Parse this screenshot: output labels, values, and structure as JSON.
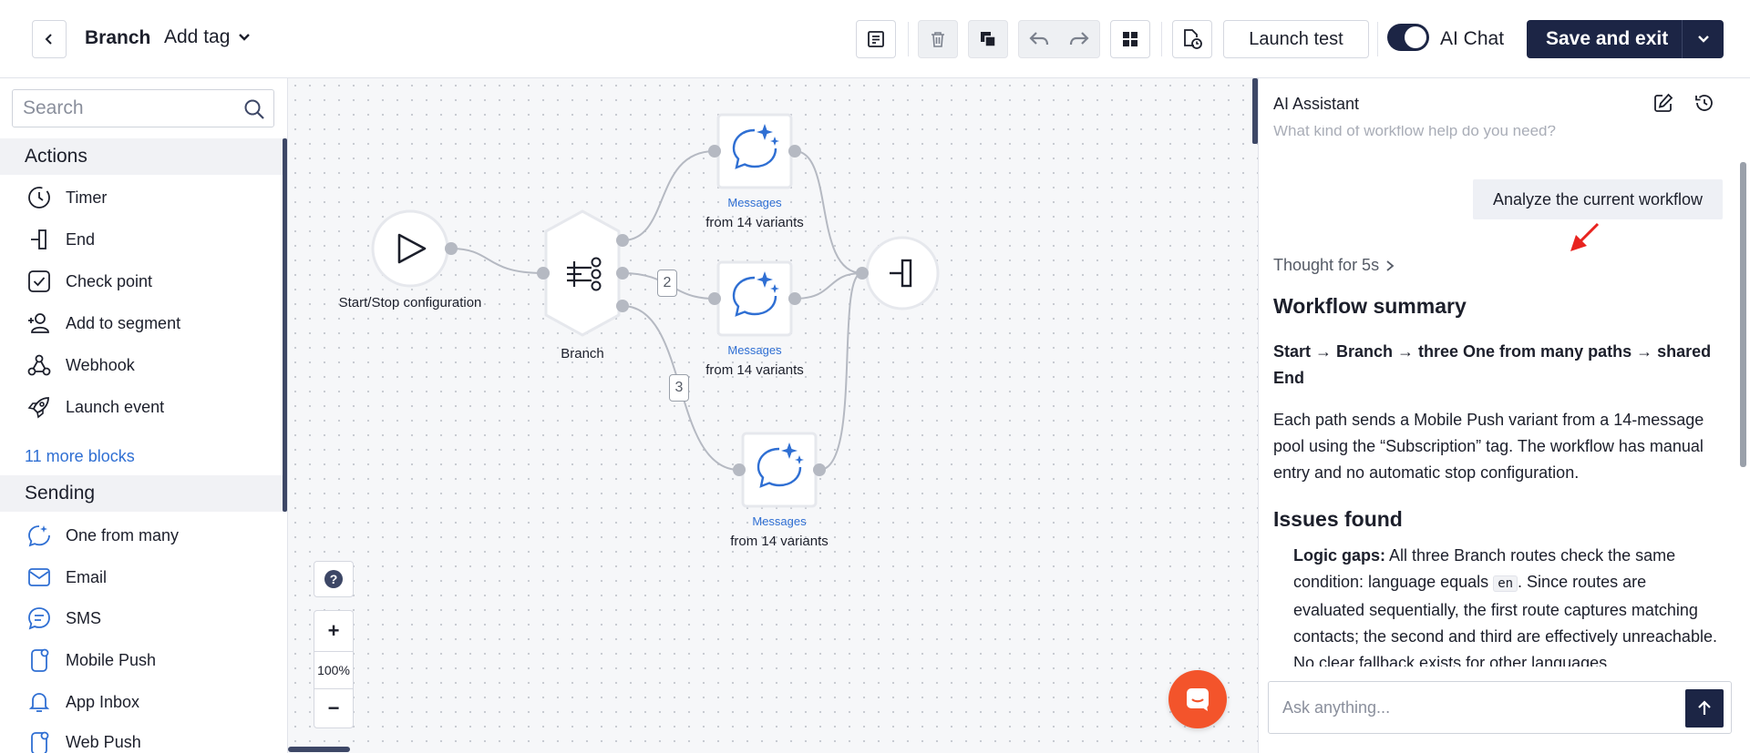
{
  "header": {
    "title": "Branch",
    "add_tag": "Add tag",
    "launch_test": "Launch test",
    "ai_chat": "AI Chat",
    "save_exit": "Save and exit"
  },
  "sidebar": {
    "search_placeholder": "Search",
    "sections": [
      {
        "title": "Actions",
        "items": [
          {
            "label": "Timer",
            "icon": "timer-icon"
          },
          {
            "label": "End",
            "icon": "end-icon"
          },
          {
            "label": "Check point",
            "icon": "checkpoint-icon"
          },
          {
            "label": "Add to segment",
            "icon": "add-segment-icon"
          },
          {
            "label": "Webhook",
            "icon": "webhook-icon"
          },
          {
            "label": "Launch event",
            "icon": "launch-event-icon"
          }
        ],
        "more": "11 more blocks"
      },
      {
        "title": "Sending",
        "items": [
          {
            "label": "One from many",
            "icon": "one-from-many-icon"
          },
          {
            "label": "Email",
            "icon": "email-icon"
          },
          {
            "label": "SMS",
            "icon": "sms-icon"
          },
          {
            "label": "Mobile Push",
            "icon": "mobile-push-icon"
          },
          {
            "label": "App Inbox",
            "icon": "app-inbox-icon"
          },
          {
            "label": "Web Push",
            "icon": "web-push-icon"
          }
        ]
      }
    ]
  },
  "canvas": {
    "nodes": {
      "start": {
        "label": "Start/Stop configuration"
      },
      "branch": {
        "label": "Branch"
      },
      "msg1": {
        "sub": "Messages",
        "label": "from 14 variants"
      },
      "msg2": {
        "sub": "Messages",
        "label": "from 14 variants"
      },
      "msg3": {
        "sub": "Messages",
        "label": "from 14 variants"
      }
    },
    "edge_labels": [
      "2",
      "3"
    ],
    "zoom": "100%",
    "zoom_in": "+",
    "zoom_out": "−",
    "help": "?"
  },
  "ai_panel": {
    "title": "AI Assistant",
    "faded_prompt": "What kind of workflow help do you need?",
    "user_message": "Analyze the current workflow",
    "thought": "Thought for 5s",
    "summary_heading": "Workflow summary",
    "summary_bold": "Start → Branch → three One from many paths → shared End",
    "summary_text": "Each path sends a Mobile Push variant from a 14-message pool using the “Subscription” tag. The workflow has manual entry and no automatic stop configuration.",
    "issues_heading": "Issues found",
    "issue1_title": "Logic gaps:",
    "issue1_pre": "All three Branch routes check the same condition: language equals",
    "issue1_code": "en",
    "issue1_post": ". Since routes are evaluated sequentially, the first route captures matching contacts; the second and third are effectively unreachable. No clear fallback exists for other languages.",
    "ask_placeholder": "Ask anything..."
  },
  "colors": {
    "primary_dark": "#1c2545",
    "link_blue": "#2f6fd3",
    "fab_orange": "#f3542b",
    "arrow_red": "#e8231f"
  }
}
